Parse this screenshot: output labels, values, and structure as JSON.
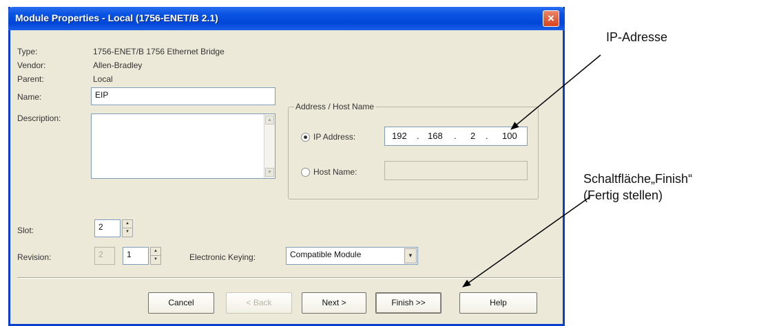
{
  "window": {
    "title": "Module Properties - Local (1756-ENET/B 2.1)",
    "close_glyph": "×"
  },
  "info": {
    "type_label": "Type:",
    "type_value": "1756-ENET/B 1756 Ethernet Bridge",
    "vendor_label": "Vendor:",
    "vendor_value": "Allen-Bradley",
    "parent_label": "Parent:",
    "parent_value": "Local"
  },
  "name": {
    "label": "Name:",
    "value": "EIP"
  },
  "description": {
    "label": "Description:",
    "value": ""
  },
  "address_group": {
    "legend": "Address / Host Name",
    "ip_option_label": "IP Address:",
    "ip_selected": true,
    "ip_octets": [
      "192",
      "168",
      "2",
      "100"
    ],
    "host_option_label": "Host Name:",
    "host_value": ""
  },
  "slot": {
    "label": "Slot:",
    "value": "2"
  },
  "revision": {
    "label": "Revision:",
    "major": "2",
    "minor": "1"
  },
  "keying": {
    "label": "Electronic Keying:",
    "selected": "Compatible Module"
  },
  "buttons": {
    "cancel": "Cancel",
    "back": "< Back",
    "next": "Next >",
    "finish": "Finish >>",
    "help": "Help"
  },
  "annotations": {
    "ip": "IP-Adresse",
    "finish_line1": "Schaltfläche„Finish“",
    "finish_line2": "(Fertig stellen)"
  },
  "colors": {
    "titlebar": "#0a54e3",
    "dialog_face": "#ece9d8",
    "close_button": "#d8431e"
  },
  "icons": {
    "close": "close-icon",
    "spin_up": "spin-up-icon",
    "spin_down": "spin-down-icon",
    "dropdown": "chevron-down-icon"
  }
}
